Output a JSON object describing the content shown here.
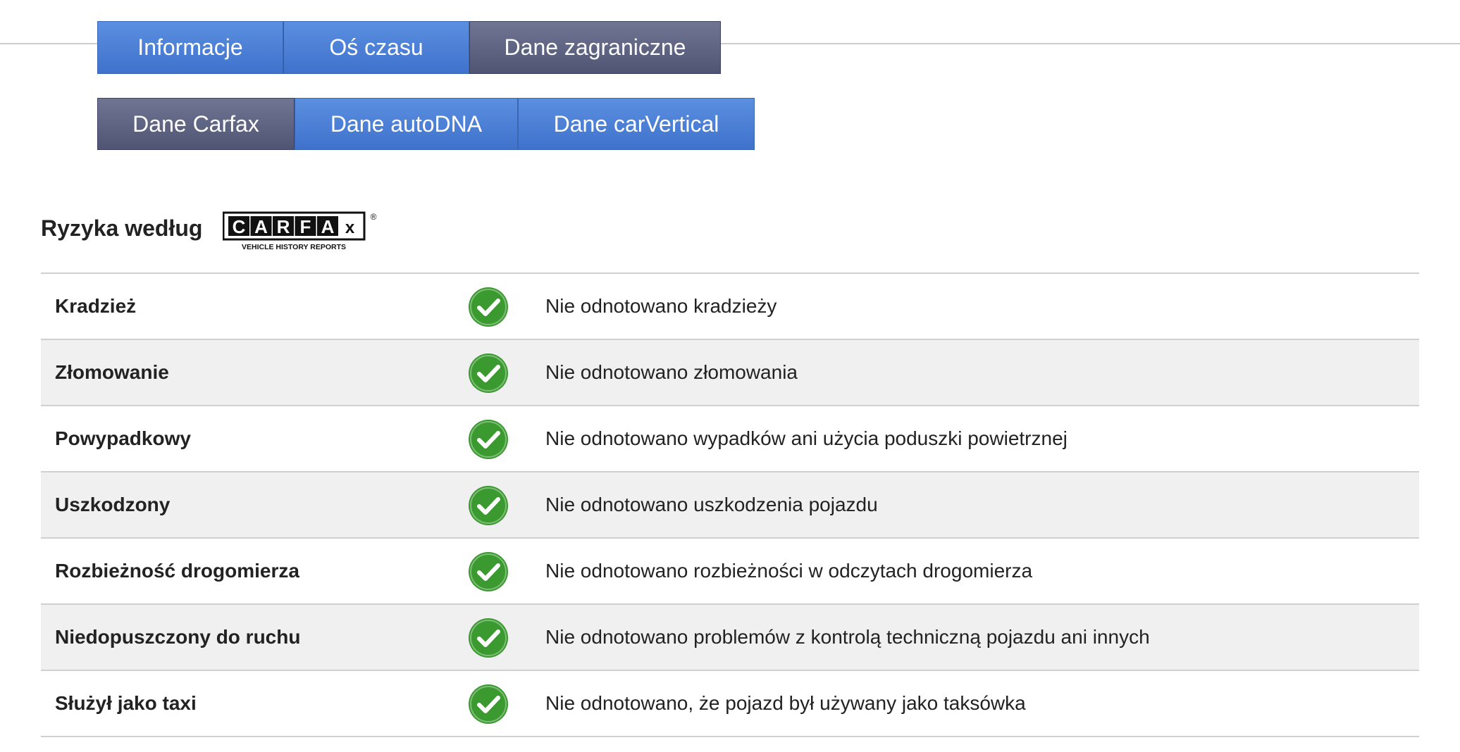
{
  "primary_tabs": [
    {
      "label": "Informacje",
      "active": false
    },
    {
      "label": "Oś czasu",
      "active": false
    },
    {
      "label": "Dane zagraniczne",
      "active": true
    }
  ],
  "secondary_tabs": [
    {
      "label": "Dane Carfax",
      "active": true
    },
    {
      "label": "Dane autoDNA",
      "active": false
    },
    {
      "label": "Dane carVertical",
      "active": false
    }
  ],
  "section": {
    "title": "Ryzyka według",
    "logo_text": "CARFAX",
    "logo_subtext": "VEHICLE HISTORY REPORTS",
    "logo_mark": "®"
  },
  "status_icon": "check-circle-icon",
  "colors": {
    "tab_blue": "#4a7fd6",
    "tab_active": "#5b6180",
    "check_green": "#3a9a2f",
    "row_alt": "#f0f0f0"
  },
  "risks": [
    {
      "label": "Kradzież",
      "status": "Nie odnotowano kradzieży"
    },
    {
      "label": "Złomowanie",
      "status": "Nie odnotowano złomowania"
    },
    {
      "label": "Powypadkowy",
      "status": "Nie odnotowano wypadków ani użycia poduszki powietrznej"
    },
    {
      "label": "Uszkodzony",
      "status": "Nie odnotowano uszkodzenia pojazdu"
    },
    {
      "label": "Rozbieżność drogomierza",
      "status": "Nie odnotowano rozbieżności w odczytach drogomierza"
    },
    {
      "label": "Niedopuszczony do ruchu",
      "status": "Nie odnotowano problemów z kontrolą techniczną pojazdu ani innych"
    },
    {
      "label": "Służył jako taxi",
      "status": "Nie odnotowano, że pojazd był używany jako taksówka"
    }
  ]
}
